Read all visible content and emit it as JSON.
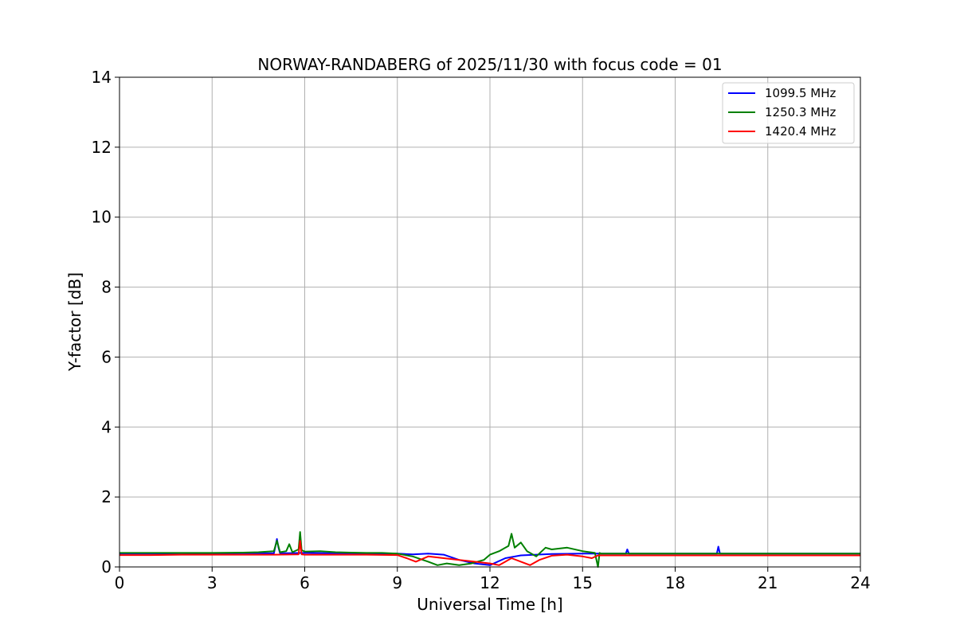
{
  "chart_data": {
    "type": "line",
    "title": "NORWAY-RANDABERG of 2025/11/30 with focus code = 01",
    "xlabel": "Universal Time [h]",
    "ylabel": "Y-factor [dB]",
    "xlim": [
      0,
      24
    ],
    "ylim": [
      0,
      14
    ],
    "xticks": [
      0,
      3,
      6,
      9,
      12,
      15,
      18,
      21,
      24
    ],
    "yticks": [
      0,
      2,
      4,
      6,
      8,
      10,
      12,
      14
    ],
    "grid": true,
    "legend_position": "top-right",
    "series": [
      {
        "name": "1099.5 MHz",
        "color": "#0000ff",
        "x": [
          0,
          1,
          2,
          3,
          4,
          5,
          5.1,
          5.15,
          5.2,
          6,
          7,
          8,
          9,
          9.5,
          10,
          10.5,
          11,
          11.5,
          12,
          12.5,
          13,
          13.5,
          14,
          15,
          16,
          16.4,
          16.45,
          16.5,
          17,
          18,
          19,
          19.35,
          19.4,
          19.45,
          20,
          21,
          22,
          23,
          24
        ],
        "y": [
          0.38,
          0.38,
          0.39,
          0.38,
          0.39,
          0.39,
          0.8,
          0.55,
          0.39,
          0.4,
          0.39,
          0.38,
          0.38,
          0.36,
          0.38,
          0.35,
          0.2,
          0.1,
          0.05,
          0.25,
          0.33,
          0.35,
          0.37,
          0.38,
          0.38,
          0.38,
          0.5,
          0.38,
          0.38,
          0.38,
          0.38,
          0.38,
          0.58,
          0.38,
          0.38,
          0.38,
          0.38,
          0.38,
          0.38
        ]
      },
      {
        "name": "1250.3 MHz",
        "color": "#008000",
        "x": [
          0,
          1,
          2,
          3,
          4,
          4.5,
          5,
          5.1,
          5.2,
          5.4,
          5.5,
          5.6,
          5.8,
          5.85,
          5.9,
          6,
          6.5,
          7,
          7.5,
          8,
          8.5,
          9,
          9.5,
          10,
          10.3,
          10.6,
          11,
          11.4,
          11.8,
          12,
          12.3,
          12.6,
          12.7,
          12.8,
          13,
          13.2,
          13.5,
          13.8,
          14,
          14.5,
          15,
          15.4,
          15.5,
          15.55,
          15.6,
          16,
          17,
          18,
          19,
          20,
          21,
          22,
          23,
          24
        ],
        "y": [
          0.4,
          0.4,
          0.4,
          0.4,
          0.41,
          0.42,
          0.45,
          0.75,
          0.42,
          0.45,
          0.65,
          0.42,
          0.5,
          1.0,
          0.48,
          0.44,
          0.45,
          0.42,
          0.41,
          0.4,
          0.4,
          0.38,
          0.3,
          0.15,
          0.05,
          0.1,
          0.05,
          0.1,
          0.2,
          0.35,
          0.45,
          0.6,
          0.95,
          0.55,
          0.7,
          0.45,
          0.3,
          0.55,
          0.5,
          0.55,
          0.45,
          0.4,
          0.0,
          0.4,
          0.38,
          0.38,
          0.38,
          0.38,
          0.38,
          0.38,
          0.38,
          0.38,
          0.38,
          0.38
        ]
      },
      {
        "name": "1420.4 MHz",
        "color": "#ff0000",
        "x": [
          0,
          1,
          2,
          3,
          4,
          5,
          5.8,
          5.85,
          5.9,
          6,
          7,
          8,
          9,
          9.3,
          9.6,
          10,
          10.5,
          11,
          11.5,
          12,
          12.3,
          12.7,
          13,
          13.3,
          13.6,
          14,
          14.5,
          15,
          15.3,
          15.5,
          16,
          17,
          18,
          19,
          20,
          21,
          22,
          23,
          24
        ],
        "y": [
          0.34,
          0.34,
          0.35,
          0.35,
          0.35,
          0.35,
          0.36,
          0.75,
          0.36,
          0.35,
          0.35,
          0.35,
          0.34,
          0.25,
          0.15,
          0.3,
          0.25,
          0.2,
          0.15,
          0.1,
          0.05,
          0.25,
          0.15,
          0.05,
          0.2,
          0.32,
          0.35,
          0.3,
          0.25,
          0.33,
          0.33,
          0.33,
          0.33,
          0.33,
          0.33,
          0.33,
          0.33,
          0.33,
          0.33
        ]
      }
    ]
  }
}
